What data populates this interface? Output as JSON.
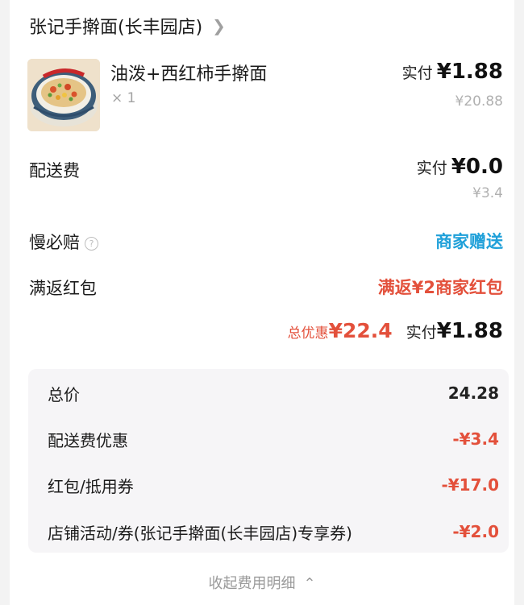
{
  "shop": {
    "name": "张记手擀面(长丰园店)"
  },
  "item": {
    "name": "油泼+西红柿手擀面",
    "qty": "× 1",
    "paid_label": "实付",
    "paid_value": "¥1.88",
    "original": "¥20.88"
  },
  "delivery": {
    "label": "配送费",
    "paid_label": "实付",
    "paid_value": "¥0.0",
    "original": "¥3.4"
  },
  "slow_comp": {
    "label": "慢必赔",
    "value": "商家赠送"
  },
  "full_return": {
    "label": "满返红包",
    "value": "满返¥2商家红包"
  },
  "summary": {
    "discount_label": "总优惠",
    "discount_value": "¥22.4",
    "paid_label": "实付",
    "paid_value": "¥1.88"
  },
  "breakdown": [
    {
      "label": "总价",
      "value": "24.28"
    },
    {
      "label": "配送费优惠",
      "value": "-¥3.4"
    },
    {
      "label": "红包/抵用券",
      "value": "-¥17.0"
    },
    {
      "label": "店铺活动/券(张记手擀面(长丰园店)专享券)",
      "value": "-¥2.0"
    }
  ],
  "collapse": {
    "label": "收起费用明细"
  },
  "colors": {
    "accent_red": "#e3503b",
    "accent_blue": "#1fa0d9"
  }
}
